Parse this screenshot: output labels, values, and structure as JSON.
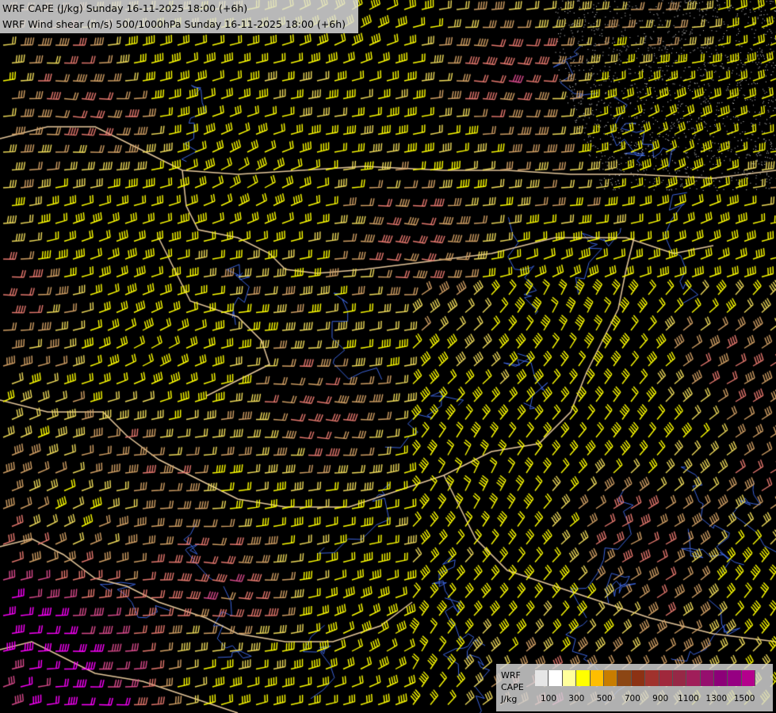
{
  "header": {
    "cape_title": "WRF CAPE (J/kg) Sunday 16-11-2025 18:00 (+6h)",
    "shear_title": "WRF Wind shear (m/s) 500/1000hPa Sunday 16-11-2025 18:00 (+6h)"
  },
  "legend": {
    "label_model": "WRF",
    "label_field": "CAPE",
    "label_unit": "J/kg",
    "colors": [
      "#e6e6e6",
      "#ffffff",
      "#ffff9c",
      "#ffff00",
      "#ffbe00",
      "#c87d00",
      "#8c4614",
      "#8c3214",
      "#a0322d",
      "#a0283c",
      "#962846",
      "#a01e5a",
      "#960f6e",
      "#8c0078",
      "#960082",
      "#b4008c"
    ],
    "ticks": [
      "100",
      "300",
      "500",
      "700",
      "900",
      "1100",
      "1300",
      "1500"
    ]
  },
  "map_style": {
    "background": "#000000",
    "barb_colors": [
      "#ffff00",
      "#f0dc5a",
      "#d2a064",
      "#e6786e",
      "#d94a8c",
      "#ff00ff"
    ],
    "border_color": "#e6c89b",
    "river_color": "#3c64dc"
  }
}
